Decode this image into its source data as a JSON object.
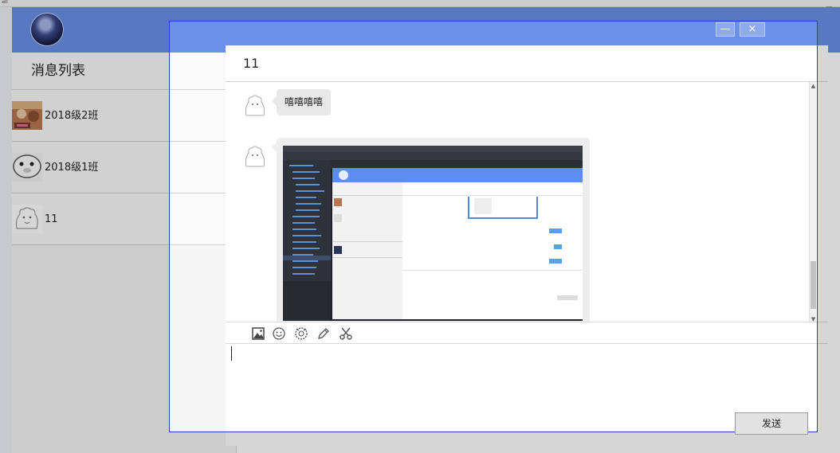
{
  "desktop": {
    "left_char": "al",
    "right_char": "己9"
  },
  "sidebar": {
    "title": "消息列表",
    "contacts": [
      {
        "name": "2018级2班"
      },
      {
        "name": "2018级1班"
      },
      {
        "name": "11"
      }
    ]
  },
  "chat": {
    "title": "11",
    "messages": [
      {
        "type": "text",
        "text": "嘻嘻嘻嘻"
      },
      {
        "type": "image"
      }
    ]
  },
  "toolbar": {
    "icons": [
      "image-icon",
      "smiley-icon",
      "sticker-icon",
      "pencil-icon",
      "scissors-icon"
    ]
  },
  "send_label": "发送",
  "window_controls": {
    "minimize": "—",
    "close": "×"
  },
  "colors": {
    "titlebar": "#6a90e8",
    "selection_border": "#2b3cd8"
  }
}
